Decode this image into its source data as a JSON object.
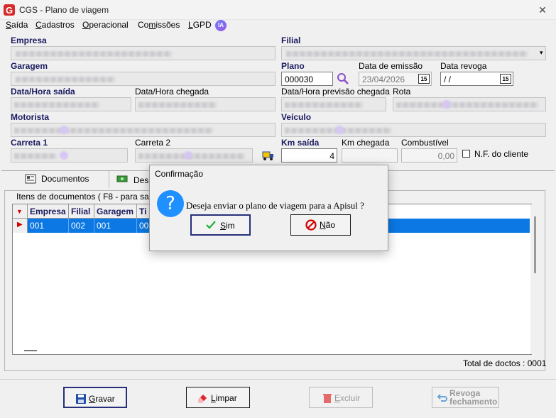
{
  "window": {
    "title": "CGS - Plano de viagem"
  },
  "menu": {
    "items": [
      {
        "pre": "",
        "ul": "S",
        "post": "aída"
      },
      {
        "pre": "",
        "ul": "C",
        "post": "adastros"
      },
      {
        "pre": "",
        "ul": "O",
        "post": "peracional"
      },
      {
        "pre": "Co",
        "ul": "m",
        "post": "issões"
      },
      {
        "pre": "",
        "ul": "L",
        "post": "GPD"
      }
    ],
    "ia_badge": "IA"
  },
  "form": {
    "empresa_label": "Empresa",
    "filial_label": "Filial",
    "garagem_label": "Garagem",
    "plano_label": "Plano",
    "plano_value": "000030",
    "data_emissao_label": "Data de emissão",
    "data_emissao_value": "23/04/2026",
    "data_revoga_label": "Data revoga",
    "data_revoga_value": " /  /",
    "data_hora_saida_label": "Data/Hora saída",
    "data_hora_chegada_label": "Data/Hora chegada",
    "data_hora_previsao_label": "Data/Hora previsão chegada",
    "rota_label": "Rota",
    "motorista_label": "Motorista",
    "veiculo_label": "Veículo",
    "carreta1_label": "Carreta 1",
    "carreta2_label": "Carreta 2",
    "km_saida_label": "Km saída",
    "km_saida_value": "4",
    "km_chegada_label": "Km chegada",
    "combustivel_label": "Combustível",
    "combustivel_value": "0,00",
    "nf_cliente_label": "N.F. do cliente",
    "calendar_icon_text": "15"
  },
  "tabs": [
    {
      "label": "Documentos"
    },
    {
      "label": "Desp"
    }
  ],
  "documents": {
    "group_title": "Itens de documentos ( F8 - para sair )",
    "columns": [
      "Empresa",
      "Filial",
      "Garagem",
      "Ti"
    ],
    "rows": [
      [
        "001",
        "002",
        "001",
        "00"
      ]
    ],
    "total": "Total de doctos : 0001"
  },
  "buttons": {
    "gravar": {
      "ul": "G",
      "rest": "ravar"
    },
    "limpar": {
      "ul": "L",
      "rest": "impar"
    },
    "excluir": {
      "ul": "E",
      "rest": "xcluir"
    },
    "revoga_line1": "Revoga",
    "revoga_line2": "fechamento"
  },
  "dialog": {
    "title": "Confirmação",
    "message": "Deseja enviar o plano de viagem para a Apisul ?",
    "yes": {
      "ul": "S",
      "rest": "im"
    },
    "no": {
      "ul": "N",
      "rest": "ão"
    }
  },
  "colors": {
    "selection": "#0b78e3",
    "label_bold": "#1a1a60",
    "dialog_icon": "#1e90ff",
    "logo_red": "#d62b2b"
  }
}
